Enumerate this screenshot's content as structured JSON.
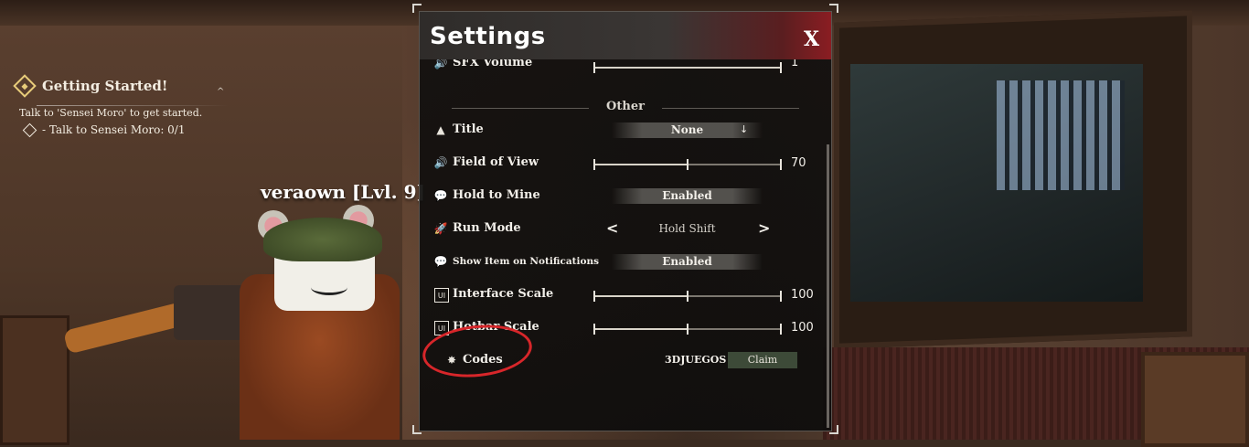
{
  "quest": {
    "title": "Getting Started!",
    "description": "Talk to 'Sensei Moro' to get started.",
    "task": "- Talk to Sensei Moro: 0/1"
  },
  "player": {
    "name_tag": "veraown [Lvl. 9]"
  },
  "settings": {
    "title": "Settings",
    "close_label": "X",
    "sfx_volume": {
      "label": "SFX Volume",
      "value": "1",
      "fraction": 1.0
    },
    "section_other": "Other",
    "title_setting": {
      "label": "Title",
      "value": "None",
      "arrow": "↓"
    },
    "field_of_view": {
      "label": "Field of View",
      "value": "70",
      "fraction": 0.5
    },
    "hold_to_mine": {
      "label": "Hold to Mine",
      "value": "Enabled"
    },
    "run_mode": {
      "label": "Run Mode",
      "value": "Hold Shift",
      "prev": "<",
      "next": ">"
    },
    "show_item_notifications": {
      "label": "Show Item on Notifications",
      "value": "Enabled"
    },
    "interface_scale": {
      "label": "Interface Scale",
      "value": "100",
      "fraction": 0.5,
      "icon_text": "UI"
    },
    "hotbar_scale": {
      "label": "Hotbar Scale",
      "value": "100",
      "fraction": 0.5,
      "icon_text": "UI"
    },
    "codes": {
      "label": "Codes",
      "code_value": "3DJUEGOS",
      "claim_label": "Claim"
    }
  },
  "colors": {
    "header_gradient_end": "#8a1d22",
    "claim_button": "#3d4a38",
    "annotation": "#d7262a",
    "quest_accent": "#e8cc7a"
  },
  "icons": {
    "quest": "diamond-quest-icon",
    "sfx": "speaker-icon",
    "title": "hat-icon",
    "fov": "speaker-icon",
    "hold_to_mine": "chat-bubble-icon",
    "run_mode": "running-shoe-icon",
    "notifications": "chat-bubble-icon",
    "interface_scale": "ui-icon",
    "hotbar_scale": "ui-icon",
    "codes": "sparkle-icon"
  }
}
